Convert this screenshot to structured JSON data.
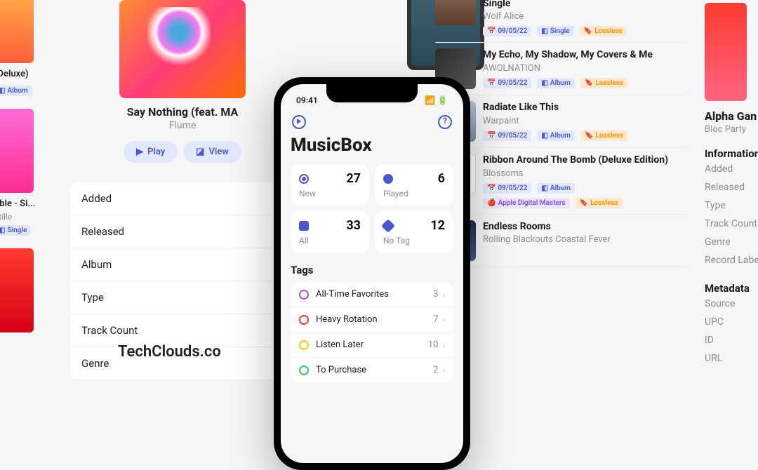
{
  "left": {
    "deluxeLabel": "(Deluxe)",
    "albumBadge": "Album",
    "singleLabel": "uble - Si...",
    "singleArtist": "stille",
    "singleBadge": "Single"
  },
  "center": {
    "title": "Say Nothing (feat. MA",
    "artist": "Flume",
    "playLabel": "Play",
    "viewLabel": "View",
    "info": [
      "Added",
      "Released",
      "Album",
      "Type",
      "Track Count",
      "Genre"
    ]
  },
  "phone": {
    "time": "09:41",
    "appTitle": "MusicBox",
    "stats": [
      {
        "label": "New",
        "value": "27"
      },
      {
        "label": "Played",
        "value": "6"
      },
      {
        "label": "All",
        "value": "33"
      },
      {
        "label": "No Tag",
        "value": "12"
      }
    ],
    "tagsHeader": "Tags",
    "tags": [
      {
        "name": "All-Time Favorites",
        "count": "3"
      },
      {
        "name": "Heavy Rotation",
        "count": "7"
      },
      {
        "name": "Listen Later",
        "count": "10"
      },
      {
        "name": "To Purchase",
        "count": "2"
      }
    ]
  },
  "tracks": [
    {
      "title": "The Last Man On Earth (Lullaby Version) - Single",
      "artist": "Wolf Alice",
      "date": "09/05/22",
      "type": "Single",
      "lossless": "Lossless"
    },
    {
      "title": "My Echo, My Shadow, My Covers & Me",
      "artist": "AWOLNATION",
      "date": "09/05/22",
      "type": "Album",
      "lossless": "Lossless"
    },
    {
      "title": "Radiate Like This",
      "artist": "Warpaint",
      "date": "09/05/22",
      "type": "Album",
      "lossless": "Lossless"
    },
    {
      "title": "Ribbon Around The Bomb (Deluxe Edition)",
      "artist": "Blossoms",
      "date": "09/05/22",
      "type": "Album",
      "adm": "Apple Digital Masters",
      "lossless": "Lossless"
    },
    {
      "title": "Endless Rooms",
      "artist": "Rolling Blackouts Coastal Fever"
    }
  ],
  "detail": {
    "title": "Alpha Gan",
    "artist": "Bloc Party",
    "infoHeader": "Information",
    "infoRows": [
      "Added",
      "Released",
      "Type",
      "Track Count",
      "Genre",
      "Record Label"
    ],
    "metaHeader": "Metadata",
    "metaRows": [
      "Source",
      "UPC",
      "ID",
      "URL"
    ]
  },
  "watermark": "TechClouds.co"
}
